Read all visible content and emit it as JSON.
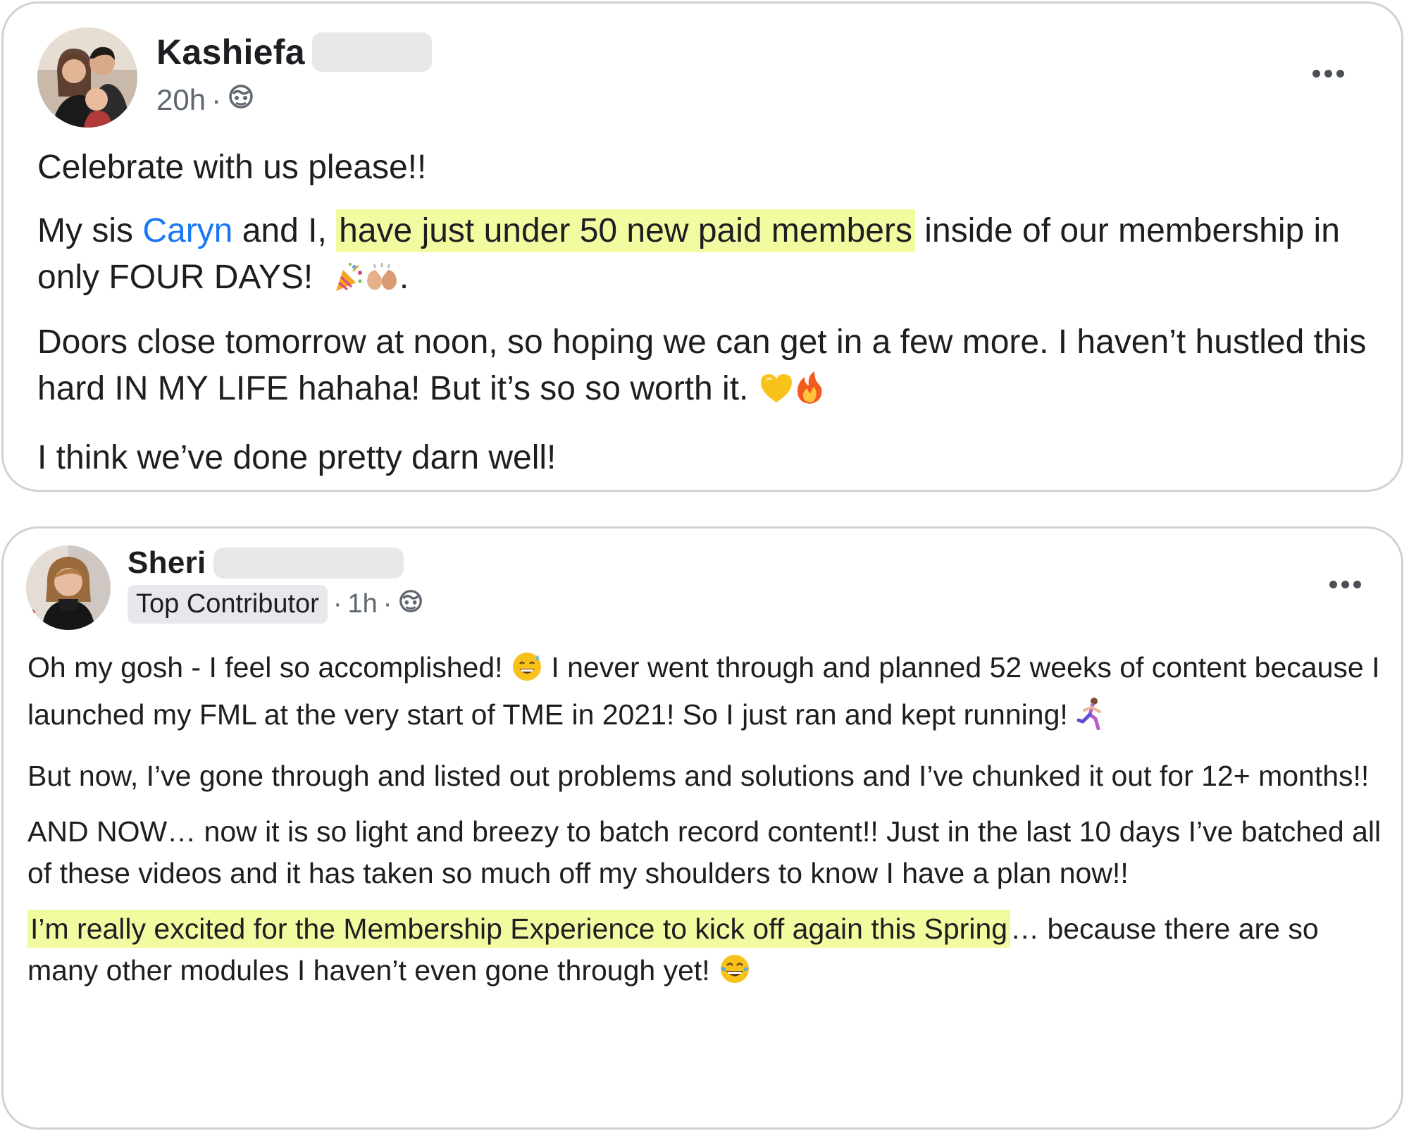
{
  "post1": {
    "author": "Kashiefa",
    "time": "20h",
    "separator": "·",
    "paragraphs": {
      "p1": "Celebrate with us please!!",
      "p2_pre": "My sis ",
      "p2_mention": "Caryn",
      "p2_mid": " and I, ",
      "p2_highlight": "have just under 50 new paid members",
      "p2_post": " inside of our membership in only FOUR DAYS!",
      "p2_end": ".",
      "p3": "Doors close tomorrow at noon, so hoping we can get in a few more. I haven’t hustled this hard IN MY LIFE hahaha! But it’s so so worth it.",
      "p4": "I think we’ve done pretty darn well!"
    }
  },
  "post2": {
    "author": "Sheri",
    "badge": "Top Contributor",
    "separator": "·",
    "time": "1h",
    "paragraphs": {
      "p1_a": "Oh my gosh - I feel so accomplished!",
      "p1_b": " I never went through and planned 52 weeks of content because I launched my FML at the very start of TME in 2021! So I just ran and kept running!",
      "p2": "But now, I’ve gone through and listed out problems and solutions and I’ve chunked it out for 12+ months!!",
      "p3": "AND NOW… now it is so light and breezy to batch record content!! Just in the last 10 days I’ve batched all of these videos and it has taken so much off my shoulders to know I have a plan now!!",
      "p4_highlight": "I’m really excited for the Membership Experience to kick off again this Spring",
      "p4_post": "… because there are so many other modules I haven’t even gone through yet!"
    }
  },
  "icons": {
    "globe": "globe-icon",
    "more": "more-options-icon",
    "emojis": [
      "party-popper-emoji",
      "clapping-hands-emoji",
      "yellow-heart-emoji",
      "fire-emoji",
      "grinning-sweat-emoji",
      "running-woman-emoji",
      "tears-of-joy-emoji"
    ]
  },
  "colors": {
    "highlight": "#f3fba1",
    "mention": "#1877f2",
    "card_border": "#d2d2d4",
    "badge_bg": "#e7e8ec"
  }
}
